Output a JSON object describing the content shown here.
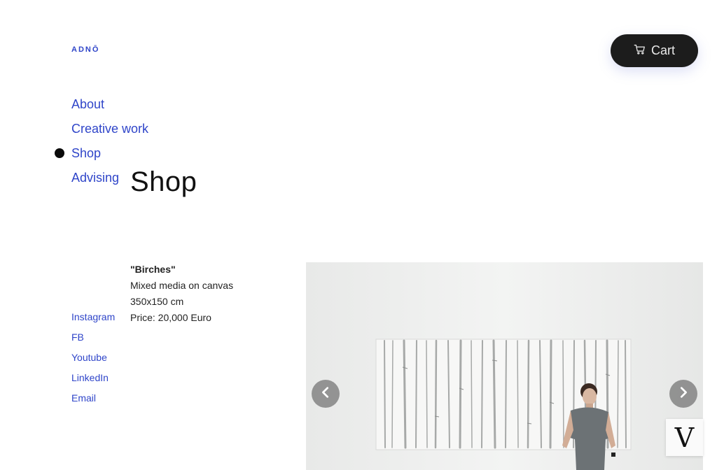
{
  "brand": {
    "logo_text": "ADNŌ"
  },
  "header": {
    "cart_label": "Cart",
    "cart_icon": "cart-icon"
  },
  "nav": {
    "items": [
      {
        "label": "About"
      },
      {
        "label": "Creative work"
      },
      {
        "label": "Shop",
        "active": true
      },
      {
        "label": "Advising"
      }
    ]
  },
  "page": {
    "title": "Shop"
  },
  "product": {
    "name": "\"Birches\"",
    "medium": "Mixed media on canvas",
    "size": "350x150 cm",
    "price": "Price: 20,000 Euro"
  },
  "social": {
    "items": [
      {
        "label": "Instagram"
      },
      {
        "label": "FB"
      },
      {
        "label": "Youtube"
      },
      {
        "label": "LinkedIn"
      },
      {
        "label": "Email"
      }
    ]
  },
  "gallery": {
    "prev_icon": "chevron-left-icon",
    "next_icon": "chevron-right-icon"
  },
  "badge": {
    "text": "V"
  },
  "colors": {
    "accent": "#2f45c9",
    "dark": "#1c1c1c",
    "background": "#ffffff"
  }
}
